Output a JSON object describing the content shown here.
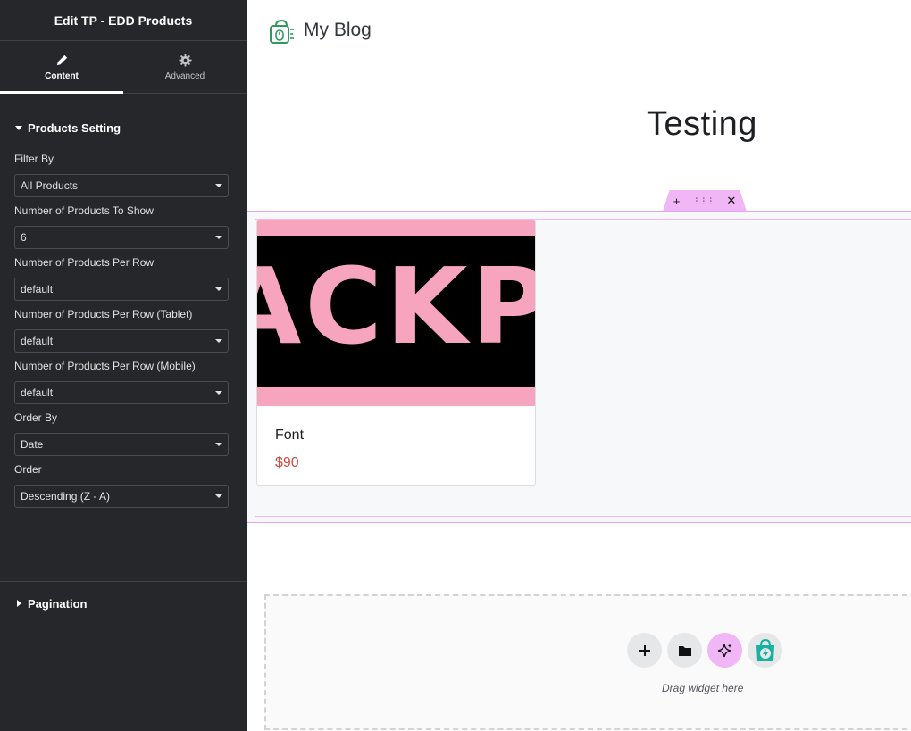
{
  "panel": {
    "title": "Edit TP - EDD Products",
    "tabs": [
      {
        "label": "Content",
        "icon": "pencil-icon",
        "active": true
      },
      {
        "label": "Advanced",
        "icon": "gear-icon",
        "active": false
      }
    ],
    "products_section": {
      "title": "Products Setting",
      "expanded": true,
      "fields": [
        {
          "label": "Filter By",
          "value": "All Products"
        },
        {
          "label": "Number of Products To Show",
          "value": "6"
        },
        {
          "label": "Number of Products Per Row",
          "value": "default"
        },
        {
          "label": "Number of Products Per Row (Tablet)",
          "value": "default"
        },
        {
          "label": "Number of Products Per Row (Mobile)",
          "value": "default"
        },
        {
          "label": "Order By",
          "value": "Date"
        },
        {
          "label": "Order",
          "value": "Descending (Z - A)"
        }
      ]
    },
    "pagination_section": {
      "title": "Pagination",
      "expanded": false
    }
  },
  "canvas": {
    "site_title": "My Blog",
    "page_title": "Testing",
    "section_handle": {
      "add": "+",
      "move": "⋮⋮⋮",
      "remove": "✕"
    },
    "product": {
      "name": "Font",
      "price": "$90",
      "image_text": "ACKP"
    },
    "drop_zone": {
      "text": "Drag widget here"
    }
  },
  "colors": {
    "panel_bg": "#26272b",
    "accent_pink": "#f0b6f6",
    "price_red": "#d0483f",
    "product_pink": "#f7a4be",
    "logo_green": "#2e9a5f"
  }
}
